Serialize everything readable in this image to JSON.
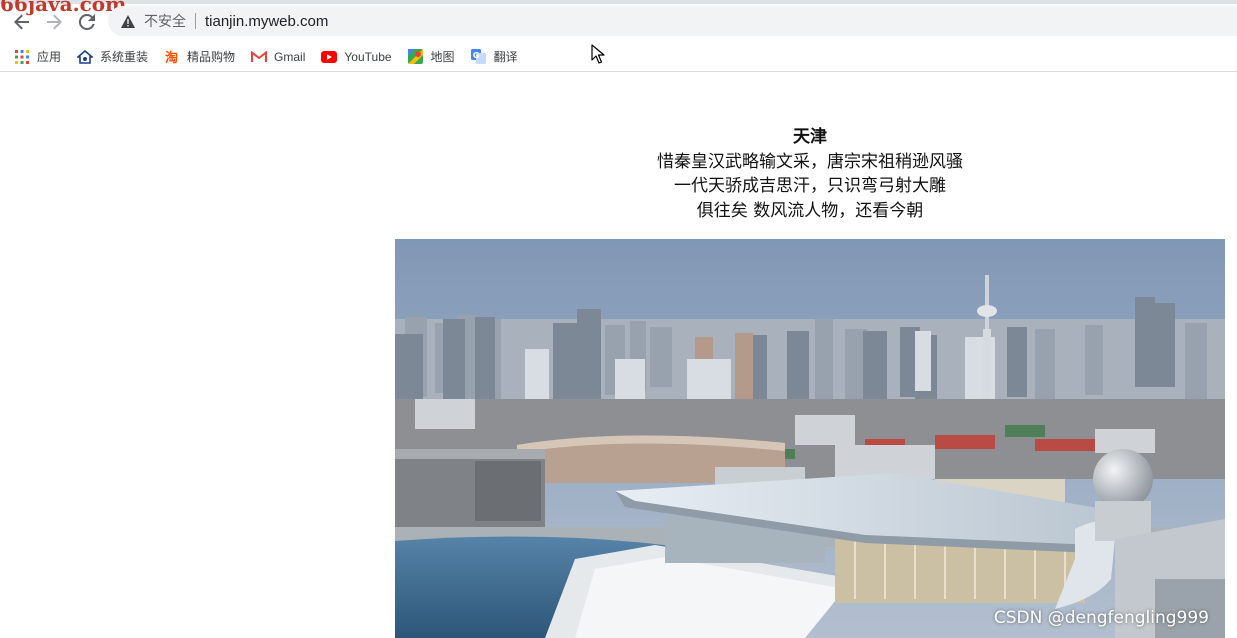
{
  "watermark": "66java.com",
  "address_bar": {
    "security_label": "不安全",
    "url": "tianjin.myweb.com"
  },
  "bookmarks": [
    {
      "label": "应用",
      "icon": "apps-grid-icon"
    },
    {
      "label": "系统重装",
      "icon": "system-reinstall-icon"
    },
    {
      "label": "精品购物",
      "icon": "taobao-icon"
    },
    {
      "label": "Gmail",
      "icon": "gmail-icon"
    },
    {
      "label": "YouTube",
      "icon": "youtube-icon"
    },
    {
      "label": "地图",
      "icon": "maps-icon"
    },
    {
      "label": "翻译",
      "icon": "translate-icon"
    }
  ],
  "page": {
    "title": "天津",
    "lines": [
      "惜秦皇汉武略输文采，唐宗宋祖稍逊风骚",
      "一代天骄成吉思汗，只识弯弓射大雕",
      "俱往矣 数风流人物，还看今朝"
    ],
    "image_watermark": "CSDN @dengfengling999"
  },
  "colors": {
    "sky": "#8fa3be",
    "water": "#3f6f95",
    "accent_red": "#c0392b"
  }
}
